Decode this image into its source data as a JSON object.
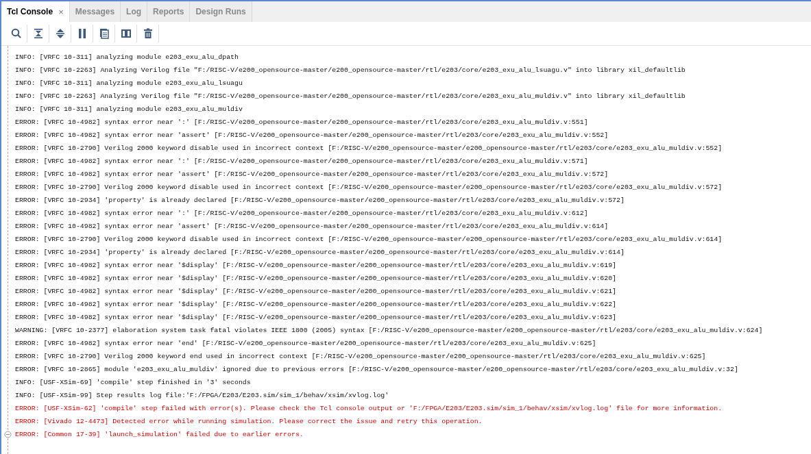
{
  "tabs": [
    {
      "label": "Tcl Console",
      "selected": true,
      "close": "×"
    },
    {
      "label": "Messages",
      "selected": false
    },
    {
      "label": "Log",
      "selected": false
    },
    {
      "label": "Reports",
      "selected": false
    },
    {
      "label": "Design Runs",
      "selected": false
    }
  ],
  "console": {
    "lines": [
      {
        "kind": "normal",
        "text": "INFO: [VRFC 10-311] analyzing module e203_exu_alu_dpath"
      },
      {
        "kind": "normal",
        "text": "INFO: [VRFC 10-2263] Analyzing Verilog file \"F:/RISC-V/e200_opensource-master/e200_opensource-master/rtl/e203/core/e203_exu_alu_lsuagu.v\" into library xil_defaultlib"
      },
      {
        "kind": "normal",
        "text": "INFO: [VRFC 10-311] analyzing module e203_exu_alu_lsuagu"
      },
      {
        "kind": "normal",
        "text": "INFO: [VRFC 10-2263] Analyzing Verilog file \"F:/RISC-V/e200_opensource-master/e200_opensource-master/rtl/e203/core/e203_exu_alu_muldiv.v\" into library xil_defaultlib"
      },
      {
        "kind": "normal",
        "text": "INFO: [VRFC 10-311] analyzing module e203_exu_alu_muldiv"
      },
      {
        "kind": "normal",
        "text": "ERROR: [VRFC 10-4982] syntax error near ':' [F:/RISC-V/e200_opensource-master/e200_opensource-master/rtl/e203/core/e203_exu_alu_muldiv.v:551]"
      },
      {
        "kind": "normal",
        "text": "ERROR: [VRFC 10-4982] syntax error near 'assert' [F:/RISC-V/e200_opensource-master/e200_opensource-master/rtl/e203/core/e203_exu_alu_muldiv.v:552]"
      },
      {
        "kind": "normal",
        "text": "ERROR: [VRFC 10-2790] Verilog 2000 keyword disable used in incorrect context [F:/RISC-V/e200_opensource-master/e200_opensource-master/rtl/e203/core/e203_exu_alu_muldiv.v:552]"
      },
      {
        "kind": "normal",
        "text": "ERROR: [VRFC 10-4982] syntax error near ':' [F:/RISC-V/e200_opensource-master/e200_opensource-master/rtl/e203/core/e203_exu_alu_muldiv.v:571]"
      },
      {
        "kind": "normal",
        "text": "ERROR: [VRFC 10-4982] syntax error near 'assert' [F:/RISC-V/e200_opensource-master/e200_opensource-master/rtl/e203/core/e203_exu_alu_muldiv.v:572]"
      },
      {
        "kind": "normal",
        "text": "ERROR: [VRFC 10-2790] Verilog 2000 keyword disable used in incorrect context [F:/RISC-V/e200_opensource-master/e200_opensource-master/rtl/e203/core/e203_exu_alu_muldiv.v:572]"
      },
      {
        "kind": "normal",
        "text": "ERROR: [VRFC 10-2934] 'property' is already declared [F:/RISC-V/e200_opensource-master/e200_opensource-master/rtl/e203/core/e203_exu_alu_muldiv.v:572]"
      },
      {
        "kind": "normal",
        "text": "ERROR: [VRFC 10-4982] syntax error near ':' [F:/RISC-V/e200_opensource-master/e200_opensource-master/rtl/e203/core/e203_exu_alu_muldiv.v:612]"
      },
      {
        "kind": "normal",
        "text": "ERROR: [VRFC 10-4982] syntax error near 'assert' [F:/RISC-V/e200_opensource-master/e200_opensource-master/rtl/e203/core/e203_exu_alu_muldiv.v:614]"
      },
      {
        "kind": "normal",
        "text": "ERROR: [VRFC 10-2790] Verilog 2000 keyword disable used in incorrect context [F:/RISC-V/e200_opensource-master/e200_opensource-master/rtl/e203/core/e203_exu_alu_muldiv.v:614]"
      },
      {
        "kind": "normal",
        "text": "ERROR: [VRFC 10-2934] 'property' is already declared [F:/RISC-V/e200_opensource-master/e200_opensource-master/rtl/e203/core/e203_exu_alu_muldiv.v:614]"
      },
      {
        "kind": "normal",
        "text": "ERROR: [VRFC 10-4982] syntax error near '$display' [F:/RISC-V/e200_opensource-master/e200_opensource-master/rtl/e203/core/e203_exu_alu_muldiv.v:619]"
      },
      {
        "kind": "normal",
        "text": "ERROR: [VRFC 10-4982] syntax error near '$display' [F:/RISC-V/e200_opensource-master/e200_opensource-master/rtl/e203/core/e203_exu_alu_muldiv.v:620]"
      },
      {
        "kind": "normal",
        "text": "ERROR: [VRFC 10-4982] syntax error near '$display' [F:/RISC-V/e200_opensource-master/e200_opensource-master/rtl/e203/core/e203_exu_alu_muldiv.v:621]"
      },
      {
        "kind": "normal",
        "text": "ERROR: [VRFC 10-4982] syntax error near '$display' [F:/RISC-V/e200_opensource-master/e200_opensource-master/rtl/e203/core/e203_exu_alu_muldiv.v:622]"
      },
      {
        "kind": "normal",
        "text": "ERROR: [VRFC 10-4982] syntax error near '$display' [F:/RISC-V/e200_opensource-master/e200_opensource-master/rtl/e203/core/e203_exu_alu_muldiv.v:623]"
      },
      {
        "kind": "normal",
        "text": "WARNING: [VRFC 10-2377] elaboration system task fatal violates IEEE 1800 (2005) syntax [F:/RISC-V/e200_opensource-master/e200_opensource-master/rtl/e203/core/e203_exu_alu_muldiv.v:624]"
      },
      {
        "kind": "normal",
        "text": "ERROR: [VRFC 10-4982] syntax error near 'end' [F:/RISC-V/e200_opensource-master/e200_opensource-master/rtl/e203/core/e203_exu_alu_muldiv.v:625]"
      },
      {
        "kind": "normal",
        "text": "ERROR: [VRFC 10-2790] Verilog 2000 keyword end used in incorrect context [F:/RISC-V/e200_opensource-master/e200_opensource-master/rtl/e203/core/e203_exu_alu_muldiv.v:625]"
      },
      {
        "kind": "normal",
        "text": "ERROR: [VRFC 10-2865] module 'e203_exu_alu_muldiv' ignored due to previous errors [F:/RISC-V/e200_opensource-master/e200_opensource-master/rtl/e203/core/e203_exu_alu_muldiv.v:32]"
      },
      {
        "kind": "normal",
        "text": "INFO: [USF-XSim-69] 'compile' step finished in '3' seconds"
      },
      {
        "kind": "normal",
        "text": "INFO: [USF-XSim-99] Step results log file:'F:/FPGA/E203/E203.sim/sim_1/behav/xsim/xvlog.log'"
      },
      {
        "kind": "error",
        "text": "ERROR: [USF-XSim-62] 'compile' step failed with error(s). Please check the Tcl console output or 'F:/FPGA/E203/E203.sim/sim_1/behav/xsim/xvlog.log' file for more information."
      },
      {
        "kind": "error",
        "text": "ERROR: [Vivado 12-4473] Detected error while running simulation. Please correct the issue and retry this operation."
      },
      {
        "kind": "error",
        "text": "ERROR: [Common 17-39] 'launch_simulation' failed due to earlier errors.",
        "fold": true
      }
    ]
  }
}
